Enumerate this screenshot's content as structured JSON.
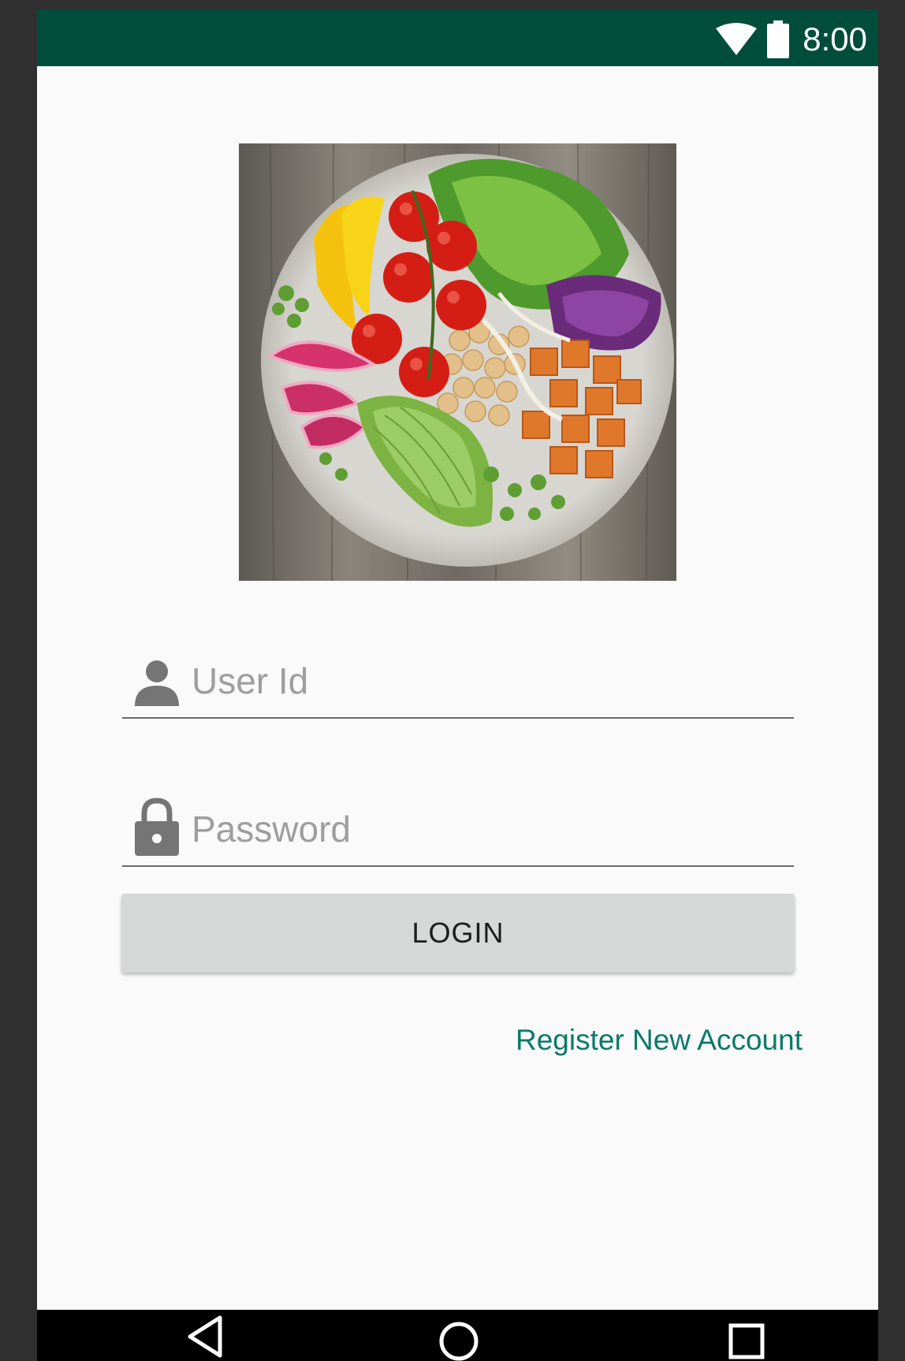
{
  "status_bar": {
    "time": "8:00",
    "icons": [
      "wifi-icon",
      "battery-icon"
    ],
    "background": "#004d3c"
  },
  "hero_image": {
    "subject": "salad-bowl-image"
  },
  "login_form": {
    "user_id": {
      "placeholder": "User Id",
      "value": "",
      "icon": "person-icon"
    },
    "password": {
      "placeholder": "Password",
      "value": "",
      "icon": "lock-icon"
    },
    "login_label": "LOGIN",
    "register_label": "Register New Account"
  },
  "colors": {
    "accent": "#0b7a6a",
    "button_bg": "#d6d7d7",
    "status_bar": "#004d3c",
    "icon_gray": "#757575"
  },
  "nav_bar": {
    "items": [
      "back-icon",
      "home-icon",
      "recents-icon"
    ]
  }
}
